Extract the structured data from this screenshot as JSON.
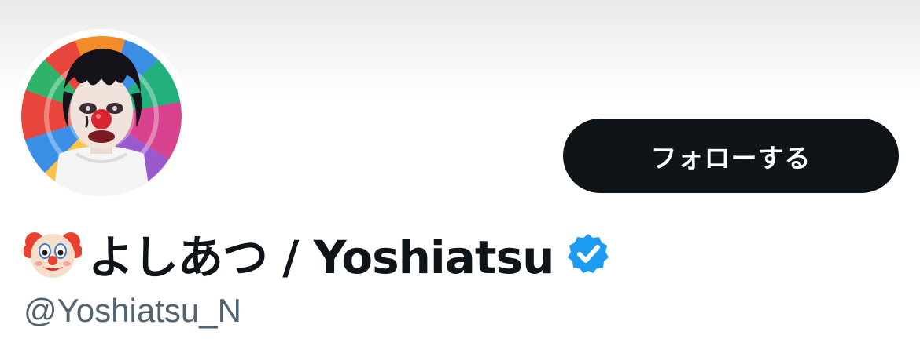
{
  "profile": {
    "display_name": "よしあつ / Yoshiatsu",
    "name_emoji_icon": "clown-face-icon",
    "verified_icon": "verified-badge-icon",
    "handle": "@Yoshiatsu_N",
    "avatar": "profile-avatar"
  },
  "actions": {
    "follow_label": "フォローする"
  },
  "colors": {
    "button_bg": "#0f1419",
    "button_text": "#ffffff",
    "name_text": "#0f1419",
    "handle_text": "#536471",
    "verified_blue": "#1d9bf0"
  }
}
